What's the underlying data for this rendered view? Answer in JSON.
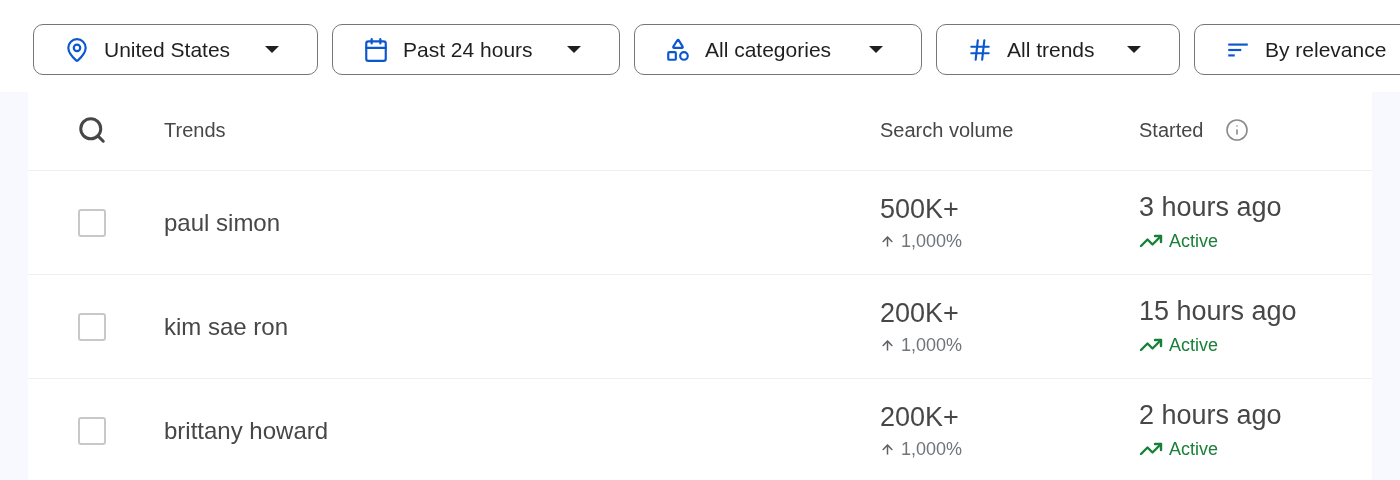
{
  "filters": [
    {
      "kind": "location",
      "label": "United States"
    },
    {
      "kind": "time",
      "label": "Past 24 hours"
    },
    {
      "kind": "category",
      "label": "All categories"
    },
    {
      "kind": "trend",
      "label": "All trends"
    },
    {
      "kind": "sort",
      "label": "By relevance"
    }
  ],
  "table": {
    "columns": [
      "Trends",
      "Search volume",
      "Started"
    ],
    "rows": [
      {
        "checked": false,
        "trend": "paul simon",
        "volume": "500K+",
        "change": "1,000%",
        "started": "3 hours ago",
        "status": "Active"
      },
      {
        "checked": false,
        "trend": "kim sae ron",
        "volume": "200K+",
        "change": "1,000%",
        "started": "15 hours ago",
        "status": "Active"
      },
      {
        "checked": false,
        "trend": "brittany howard",
        "volume": "200K+",
        "change": "1,000%",
        "started": "2 hours ago",
        "status": "Active"
      }
    ]
  }
}
